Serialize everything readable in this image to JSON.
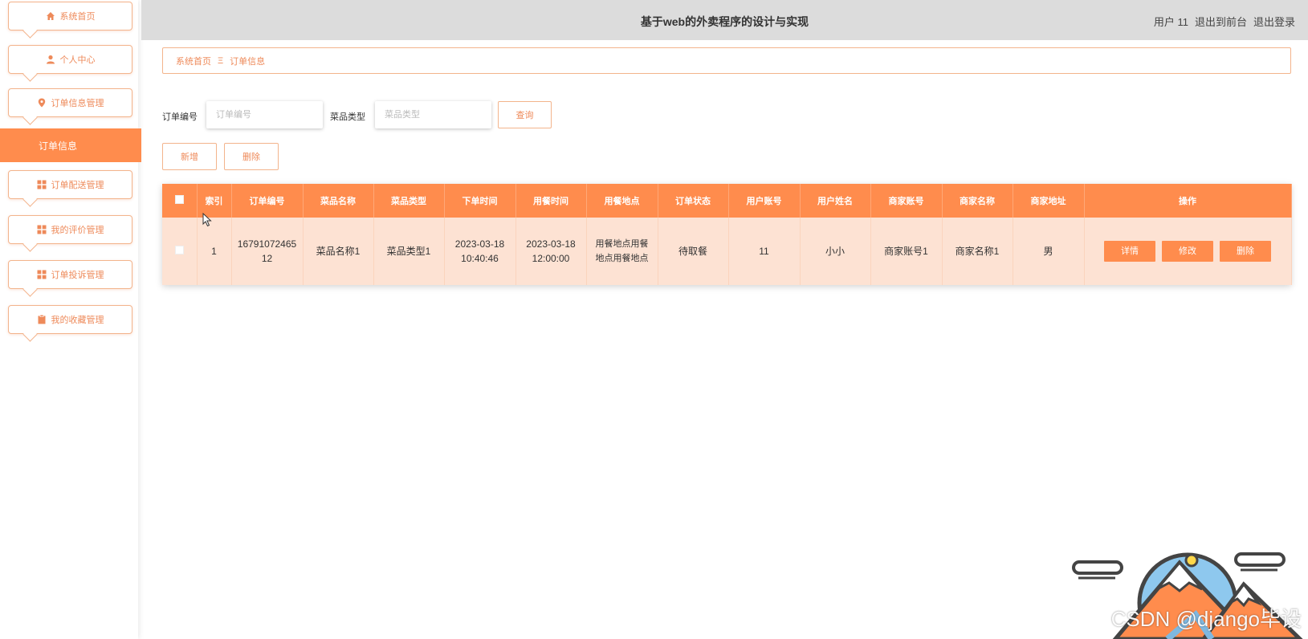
{
  "sidebar": {
    "items": [
      {
        "label": "系统首页",
        "icon": "home-icon"
      },
      {
        "label": "个人中心",
        "icon": "user-icon"
      },
      {
        "label": "订单信息管理",
        "icon": "location-pin-icon"
      },
      {
        "label": "订单配送管理",
        "icon": "grid-icon"
      },
      {
        "label": "我的评价管理",
        "icon": "grid-icon"
      },
      {
        "label": "订单投诉管理",
        "icon": "grid-icon"
      },
      {
        "label": "我的收藏管理",
        "icon": "clipboard-icon"
      }
    ],
    "active_sub": "订单信息"
  },
  "header": {
    "title": "基于web的外卖程序的设计与实现",
    "user": "用户 11",
    "to_front": "退出到前台",
    "logout": "退出登录"
  },
  "breadcrumb": {
    "home": "系统首页",
    "sep": "Ξ",
    "current": "订单信息"
  },
  "search": {
    "order_no_label": "订单编号",
    "order_no_placeholder": "订单编号",
    "order_no_value": "",
    "dish_type_label": "菜品类型",
    "dish_type_placeholder": "菜品类型",
    "dish_type_value": "",
    "query_label": "查询"
  },
  "actions": {
    "add_label": "新增",
    "delete_label": "删除"
  },
  "table": {
    "headers": [
      "索引",
      "订单编号",
      "菜品名称",
      "菜品类型",
      "下单时间",
      "用餐时间",
      "用餐地点",
      "订单状态",
      "用户账号",
      "用户姓名",
      "商家账号",
      "商家名称",
      "商家地址",
      "操作"
    ],
    "rows": [
      {
        "index": "1",
        "order_no": "1679107246512",
        "dish_name": "菜品名称1",
        "dish_type": "菜品类型1",
        "order_time": "2023-03-18 10:40:46",
        "meal_time": "2023-03-18 12:00:00",
        "meal_place": "用餐地点用餐地点用餐地点",
        "status": "待取餐",
        "user_account": "11",
        "user_name": "小小",
        "merchant_account": "商家账号1",
        "merchant_name": "商家名称1",
        "merchant_address": "男",
        "ops": {
          "detail": "详情",
          "edit": "修改",
          "delete": "删除"
        }
      }
    ]
  },
  "watermark": "CSDN @django毕设",
  "colors": {
    "accent": "#ff8c4d",
    "accent_border": "#f3b48c",
    "row_bg": "#fde2d3",
    "header_bg": "#dcdcdc"
  }
}
